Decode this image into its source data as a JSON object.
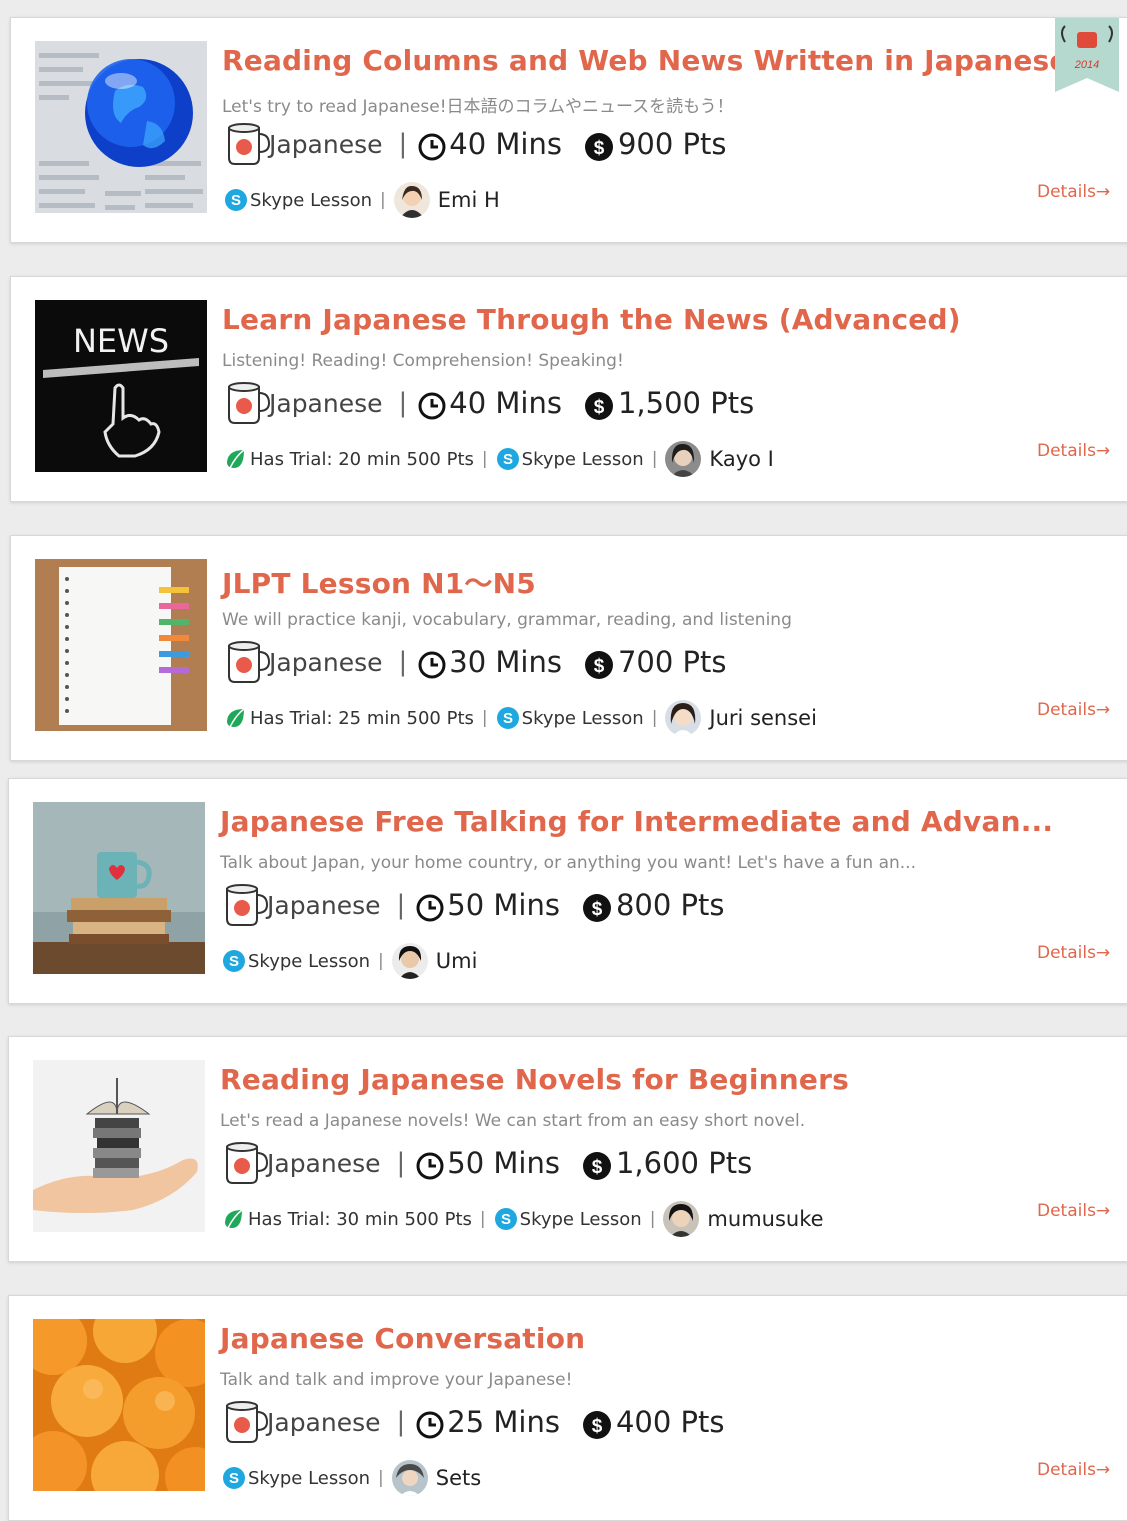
{
  "colors": {
    "accent": "#e0674c",
    "skype": "#1fa8e0",
    "trial": "#1fa85a"
  },
  "lessons": [
    {
      "title": "Reading Columns and Web News Written in Japanese",
      "description": "Let's try to read Japanese!日本語のコラムやニュースを読もう！",
      "language": "Japanese",
      "duration": "40 Mins",
      "price": "900 Pts",
      "trial": "",
      "lesson_type": "Skype Lesson",
      "teacher": "Emi H",
      "details": "Details→",
      "thumbnail": "globe-on-newspaper",
      "badge": "2014"
    },
    {
      "title": "Learn Japanese Through the News (Advanced)",
      "description": "Listening! Reading! Comprehension! Speaking!",
      "language": "Japanese",
      "duration": "40 Mins",
      "price": "1,500 Pts",
      "trial": "Has Trial: 20 min 500 Pts",
      "lesson_type": "Skype Lesson",
      "teacher": "Kayo I",
      "details": "Details→",
      "thumbnail": "news-chalkboard",
      "thumb_text": "NEWS"
    },
    {
      "title": "JLPT Lesson N1～N5",
      "description": "We will practice kanji, vocabulary, grammar, reading, and listening",
      "language": "Japanese",
      "duration": "30 Mins",
      "price": "700 Pts",
      "trial": "Has Trial: 25 min 500 Pts",
      "lesson_type": "Skype Lesson",
      "teacher": "Juri sensei",
      "details": "Details→",
      "thumbnail": "notebook-with-clips"
    },
    {
      "title": "Japanese Free Talking for Intermediate and Advan...",
      "description": "Talk about Japan, your home country, or anything you want! Let's have a fun an...",
      "language": "Japanese",
      "duration": "50 Mins",
      "price": "800 Pts",
      "trial": "",
      "lesson_type": "Skype Lesson",
      "teacher": "Umi",
      "details": "Details→",
      "thumbnail": "mug-on-books"
    },
    {
      "title": "Reading Japanese Novels for Beginners",
      "description": "Let's read a Japanese novels! We can start from an easy short novel.",
      "language": "Japanese",
      "duration": "50 Mins",
      "price": "1,600 Pts",
      "trial": "Has Trial: 30 min 500 Pts",
      "lesson_type": "Skype Lesson",
      "teacher": "mumusuke",
      "details": "Details→",
      "thumbnail": "books-on-hand"
    },
    {
      "title": "Japanese Conversation",
      "description": "Talk and talk and improve your Japanese!",
      "language": "Japanese",
      "duration": "25 Mins",
      "price": "400 Pts",
      "trial": "",
      "lesson_type": "Skype Lesson",
      "teacher": "Sets",
      "details": "Details→",
      "thumbnail": "oranges"
    }
  ]
}
